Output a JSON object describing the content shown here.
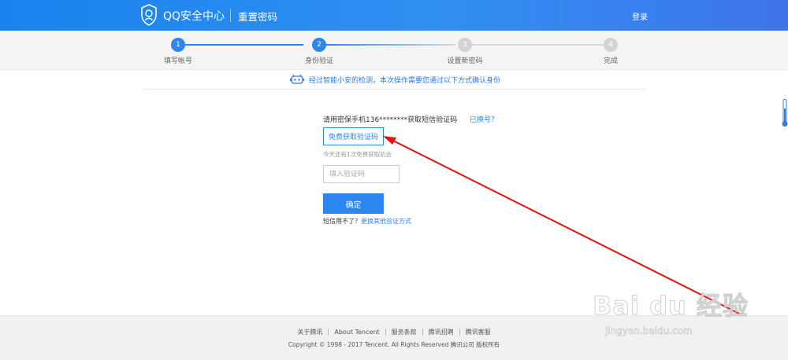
{
  "header": {
    "brand": "QQ安全中心",
    "page_name": "重置密码",
    "login_label": "登录"
  },
  "progress": {
    "steps": [
      {
        "number": "1",
        "label": "填写帐号",
        "state": "done"
      },
      {
        "number": "2",
        "label": "身份验证",
        "state": "current"
      },
      {
        "number": "3",
        "label": "设置新密码",
        "state": "pending"
      },
      {
        "number": "4",
        "label": "完成",
        "state": "pending"
      }
    ]
  },
  "notice": {
    "icon": "robot-guard-icon",
    "text": "经过智能小安的检测，本次操作需要您通过以下方式确认身份"
  },
  "verify": {
    "phone_text": "请用密保手机136********获取短信验证码",
    "change_link": "已换号？",
    "get_code_label": "免费获取验证码",
    "chance_text": "今天还有1次免费获取机会",
    "code_placeholder": "填入验证码",
    "code_value": "",
    "confirm_label": "确定",
    "alt_prefix": "短信用不了？",
    "alt_link": "更换其他验证方式"
  },
  "footer": {
    "links": [
      "关于腾讯",
      "About Tencent",
      "服务条款",
      "腾讯招聘",
      "腾讯客服"
    ],
    "copyright": "Copyright © 1998 - 2017 Tencent. All Rights Reserved 腾讯公司 版权所有"
  },
  "watermark": {
    "main": "Bai du 经验",
    "url": "jingyan.baidu.com"
  },
  "colors": {
    "accent": "#2c86ef",
    "header_start": "#1a83ee",
    "header_end": "#3f75ea",
    "annotation_arrow": "#e8120c"
  }
}
